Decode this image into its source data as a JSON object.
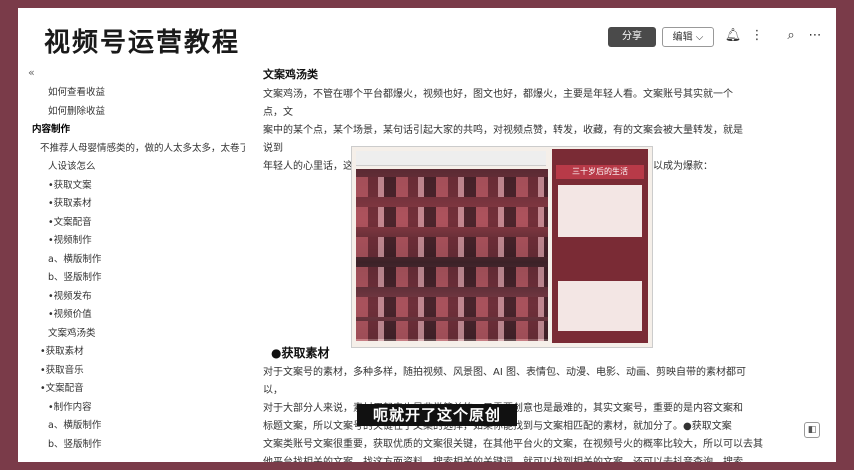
{
  "header": {
    "title": "视频号运营教程",
    "share_label": "分享",
    "edit_label": "编辑 ⌵",
    "icons": [
      "bell-icon",
      "more-icon",
      "search-icon",
      "more-horizontal-icon"
    ]
  },
  "sidebar": {
    "collapse_icon": "«",
    "items": [
      {
        "label": "如何查看收益",
        "indent": 30,
        "bold": false
      },
      {
        "label": "如何删除收益",
        "indent": 30,
        "bold": false
      },
      {
        "label": "内容制作",
        "indent": 14,
        "bold": true
      },
      {
        "label": "不推荐人母婴情感类的，做的人太多太多，太卷了",
        "indent": 22,
        "bold": false
      },
      {
        "label": "人设该怎么",
        "indent": 30,
        "bold": false
      },
      {
        "label": "•获取文案",
        "indent": 30,
        "bold": false
      },
      {
        "label": "•获取素材",
        "indent": 30,
        "bold": false
      },
      {
        "label": "•文案配音",
        "indent": 30,
        "bold": false
      },
      {
        "label": "•视频制作",
        "indent": 30,
        "bold": false
      },
      {
        "label": "a、横版制作",
        "indent": 30,
        "bold": false
      },
      {
        "label": "b、竖版制作",
        "indent": 30,
        "bold": false
      },
      {
        "label": "•视频发布",
        "indent": 30,
        "bold": false
      },
      {
        "label": "•视频价值",
        "indent": 30,
        "bold": false
      },
      {
        "label": "文案鸡汤类",
        "indent": 30,
        "bold": false
      },
      {
        "label": "•获取素材",
        "indent": 22,
        "bold": false
      },
      {
        "label": "•获取音乐",
        "indent": 22,
        "bold": false
      },
      {
        "label": "•文案配音",
        "indent": 22,
        "bold": false
      },
      {
        "label": "•制作内容",
        "indent": 30,
        "bold": false
      },
      {
        "label": "a、横版制作",
        "indent": 30,
        "bold": false
      },
      {
        "label": "b、竖版制作",
        "indent": 30,
        "bold": false
      }
    ]
  },
  "content": {
    "section_title": "文案鸡汤类",
    "intro_lines": [
      "文案鸡汤，不管在哪个平台都爆火，视频也好，图文也好，都爆火，主要是年轻人看。文案账号其实就一个点，文",
      "案中的某个点，某个场景，某句话引起大家的共鸣，对视频点赞，转发，收藏，有的文案会被大量转发，就是说到",
      "年轻人的心里话，这也是比较好制作的一个领域，一张图片，一句音频，一个画面，就可以成为爆款："
    ],
    "figure_banner": "三十岁后的生活",
    "sub_heading": "●获取素材",
    "body_lines": [
      "对于文案号的素材，多种多样，随拍视频、风景图、AI 图、表情包、动漫、电影、动画、剪映自带的素材都可以，",
      "对于大部分人来说，素材用起来也是非常简单的，只需要创意也是最难的，其实文案号，重要的是内容文案和",
      "标题文案，所以文案号的关键在于文案的选择，如果你能找到与文案相匹配的素材，就加分了。●获取文案",
      "文案类账号文案很重要，获取优质的文案很关键，在其他平台火的文案，在视频号火的概率比较大，所以可以去其",
      "他平台找相关的文案，找这方面资料，搜索相关的关键词，就可以找到相关的文案，还可以去抖音查询，搜索"
    ],
    "subtitle_overlay": "呃就开了这个原创"
  }
}
